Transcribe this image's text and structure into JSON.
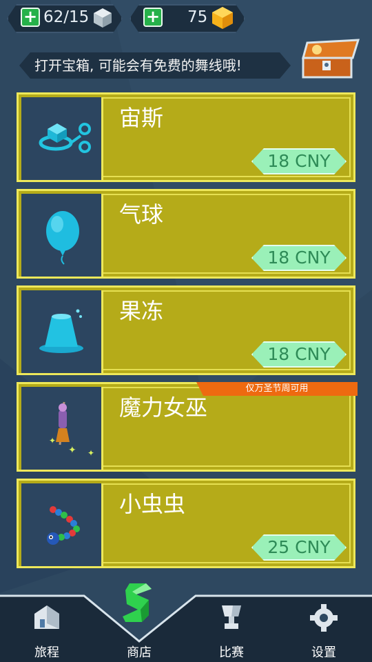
{
  "resources": {
    "dance_lines": "62/15",
    "gems": "75",
    "dance_icon": "cube-icon",
    "gem_icon": "gem-icon"
  },
  "banner": {
    "text": "打开宝箱, 可能会有免费的舞线哦!",
    "icon": "treasure-chest-icon"
  },
  "shop": {
    "items": [
      {
        "title": "宙斯",
        "price": "18 CNY",
        "icon": "zeus-cube-icon"
      },
      {
        "title": "气球",
        "price": "18 CNY",
        "icon": "balloon-icon"
      },
      {
        "title": "果冻",
        "price": "18 CNY",
        "icon": "jelly-icon"
      },
      {
        "title": "魔力女巫",
        "price": "",
        "ribbon": "仅万圣节周可用",
        "icon": "witch-broom-icon"
      },
      {
        "title": "小虫虫",
        "price": "25 CNY",
        "icon": "caterpillar-icon"
      }
    ]
  },
  "nav": {
    "items": [
      {
        "label": "旅程",
        "icon": "house-icon"
      },
      {
        "label": "商店",
        "icon": "shop-s-icon",
        "active": true
      },
      {
        "label": "比赛",
        "icon": "trophy-icon"
      },
      {
        "label": "设置",
        "icon": "gear-icon"
      }
    ]
  },
  "colors": {
    "background": "#2e4860",
    "card": "#b5ab19",
    "card_border": "#eee85a",
    "price_tag": "#9af0b8",
    "ribbon": "#ee6a10",
    "accent_green": "#26b14a"
  }
}
